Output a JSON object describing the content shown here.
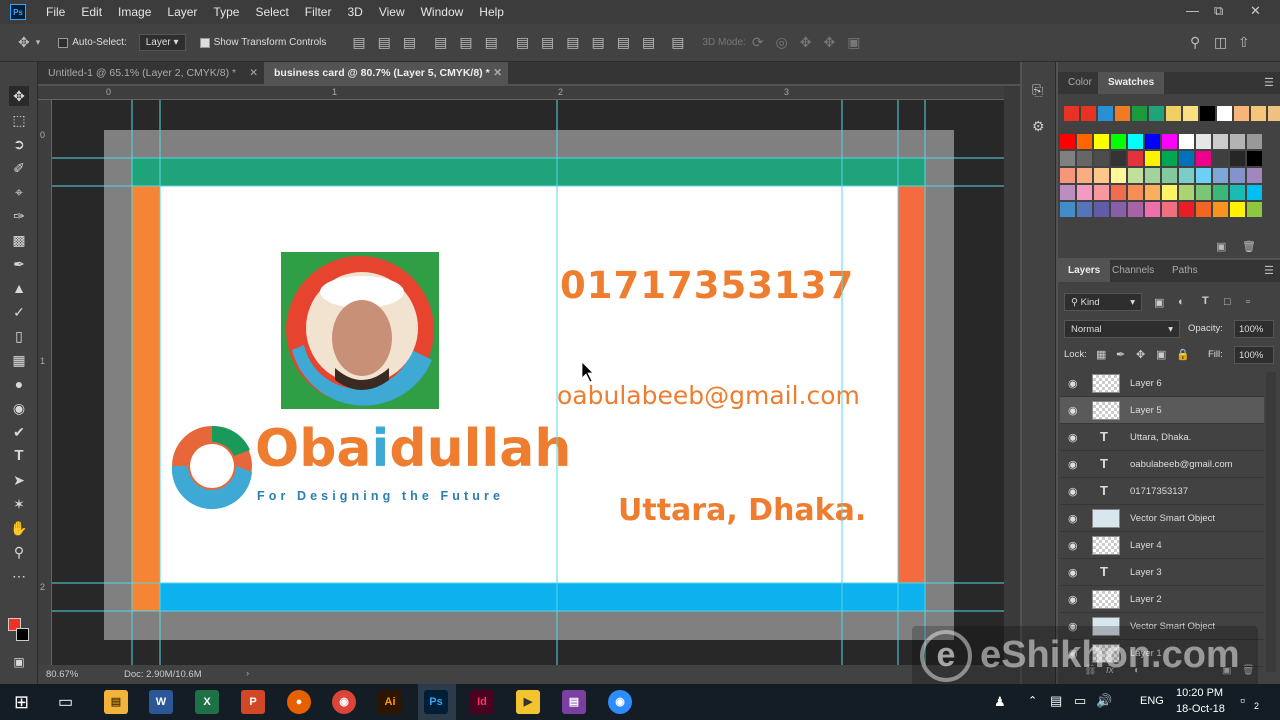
{
  "app": {
    "logo": "Ps"
  },
  "menu": [
    "File",
    "Edit",
    "Image",
    "Layer",
    "Type",
    "Select",
    "Filter",
    "3D",
    "View",
    "Window",
    "Help"
  ],
  "options": {
    "auto_select_label": "Auto-Select:",
    "auto_select_value": "Layer",
    "transform_label": "Show Transform Controls",
    "mode_3d_label": "3D Mode:"
  },
  "tabs": [
    {
      "label": "Untitled-1 @ 65.1% (Layer 2, CMYK/8) *"
    },
    {
      "label": "business card @ 80.7% (Layer 5, CMYK/8) *"
    }
  ],
  "ruler": {
    "top": [
      "0",
      "1",
      "2",
      "3"
    ],
    "left": [
      "0",
      "1",
      "2"
    ]
  },
  "card": {
    "phone": "01717353137",
    "email": "oabulabeeb@gmail.com",
    "address": "Uttara, Dhaka.",
    "brand_main": "Obaidullah",
    "brand_i": "i",
    "brand_pre": "Oba",
    "brand_post": "dullah",
    "tagline": "For Designing the Future",
    "colors": {
      "green": "#1fa37a",
      "orange": "#f58535",
      "blue": "#0db1ee",
      "text": "#ee7d2f"
    }
  },
  "status": {
    "zoom": "80.67%",
    "doc": "Doc: 2.90M/10.6M"
  },
  "swatch_tabs": [
    "Color",
    "Swatches"
  ],
  "swatch_colors": [
    [
      "#ff0000",
      "#ff6600",
      "#ffff00",
      "#00ff00",
      "#00ffff",
      "#0000ff",
      "#ff00ff",
      "#ffffff",
      "#e6e6e6",
      "#cccccc",
      "#b3b3b3",
      "#999999"
    ],
    [
      "#808080",
      "#666666",
      "#4d4d4d",
      "#333333",
      "#e3323b",
      "#fff200",
      "#00a651",
      "#0072bc",
      "#ec008c",
      "#3f3f3f",
      "#262626",
      "#000000"
    ],
    [
      "#f7977a",
      "#f9ad81",
      "#fdc68a",
      "#fff79a",
      "#c4df9b",
      "#a3d39c",
      "#82ca9d",
      "#7bcdc8",
      "#6ecff6",
      "#7ea7d8",
      "#8493ca",
      "#a187be"
    ],
    [
      "#bc8dbf",
      "#f49ac2",
      "#f6989d",
      "#f26c4f",
      "#f68e55",
      "#fbaf5c",
      "#fff467",
      "#acd372",
      "#7cc576",
      "#3bb878",
      "#1abbb4",
      "#00bff3"
    ],
    [
      "#438cca",
      "#5574b9",
      "#605ca8",
      "#855fa8",
      "#a763a8",
      "#f06eaa",
      "#f26d7d",
      "#ed1c24",
      "#f26522",
      "#f7941d",
      "#fff200",
      "#8dc73f"
    ]
  ],
  "layers_tabs": [
    "Layers",
    "Channels",
    "Paths"
  ],
  "layers_controls": {
    "kind": "Kind",
    "blend": "Normal",
    "opacity_label": "Opacity:",
    "opacity": "100%",
    "lock_label": "Lock:",
    "fill_label": "Fill:",
    "fill": "100%"
  },
  "layers": [
    {
      "name": "Layer 6",
      "kind": "pixel"
    },
    {
      "name": "Layer 5",
      "kind": "pixel",
      "selected": true
    },
    {
      "name": "Uttara, Dhaka.",
      "kind": "text"
    },
    {
      "name": "oabulabeeb@gmail.com",
      "kind": "text"
    },
    {
      "name": "01717353137",
      "kind": "text"
    },
    {
      "name": "Vector Smart Object",
      "kind": "smart"
    },
    {
      "name": "Layer 4",
      "kind": "pixel"
    },
    {
      "name": "Layer 3",
      "kind": "text"
    },
    {
      "name": "Layer 2",
      "kind": "pixel"
    },
    {
      "name": "Vector Smart Object",
      "kind": "smart"
    },
    {
      "name": "Layer 1",
      "kind": "pixel"
    }
  ],
  "watermark": "eShikhon.com",
  "taskbar": {
    "lang": "ENG",
    "time": "10:20 PM",
    "date": "18-Oct-18",
    "notif": "2"
  }
}
